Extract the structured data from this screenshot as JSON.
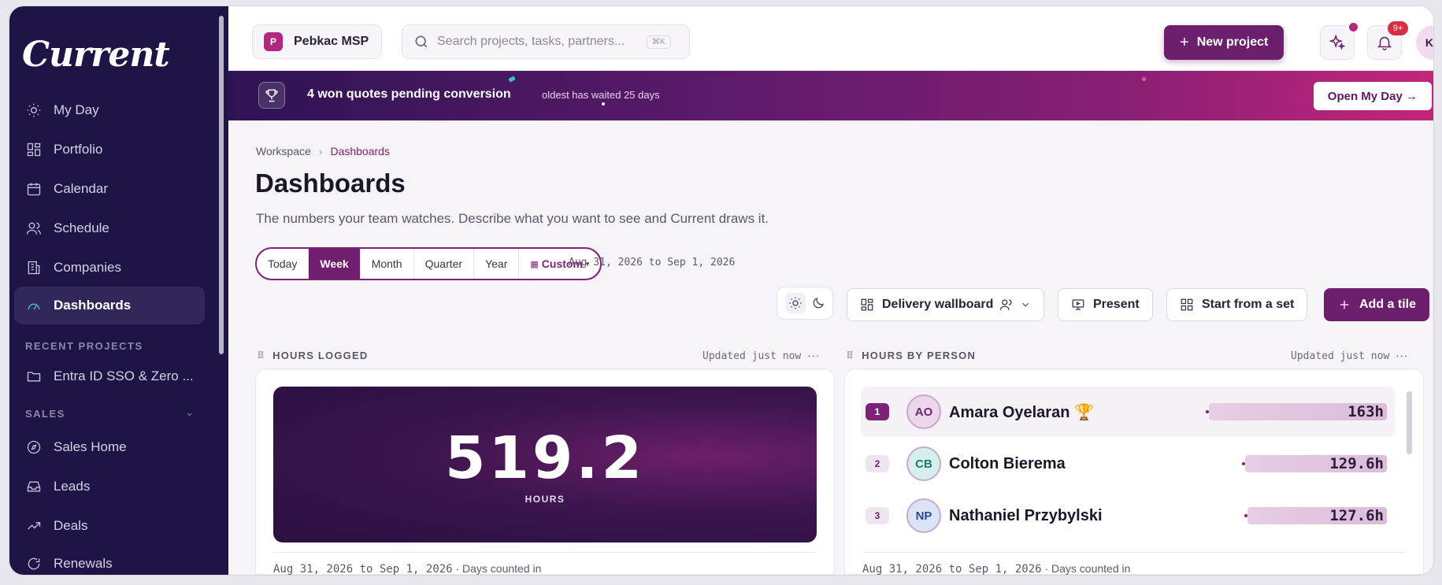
{
  "sidebar": {
    "brand": "Current",
    "nav": [
      {
        "label": "My Day",
        "icon": "sun-icon"
      },
      {
        "label": "Portfolio",
        "icon": "grid-icon"
      },
      {
        "label": "Calendar",
        "icon": "calendar-icon"
      },
      {
        "label": "Schedule",
        "icon": "people-icon"
      },
      {
        "label": "Companies",
        "icon": "building-icon"
      },
      {
        "label": "Dashboards",
        "icon": "gauge-icon",
        "active": true
      }
    ],
    "recent_title": "RECENT PROJECTS",
    "recent": [
      {
        "label": "Entra ID SSO & Zero ...",
        "icon": "folder-icon"
      }
    ],
    "sales_title": "SALES",
    "sales": [
      {
        "label": "Sales Home",
        "icon": "compass-icon"
      },
      {
        "label": "Leads",
        "icon": "inbox-icon"
      },
      {
        "label": "Deals",
        "icon": "trend-icon"
      },
      {
        "label": "Renewals",
        "icon": "refresh-icon"
      }
    ]
  },
  "topbar": {
    "workspace": {
      "badge": "P",
      "name": "Pebkac MSP"
    },
    "search": {
      "placeholder": "Search projects, tasks, partners...",
      "shortcut": "⌘K"
    },
    "new_project": "New project",
    "notif_count": "9+",
    "avatar": "KD"
  },
  "banner": {
    "title": "4 won quotes pending conversion",
    "subtitle": "oldest has waited 25 days",
    "cta": "Open My Day →"
  },
  "page": {
    "breadcrumb": [
      "Workspace",
      "Dashboards"
    ],
    "title": "Dashboards",
    "subtitle": "The numbers your team watches. Describe what you want to see and Current draws it.",
    "ranges": [
      "Today",
      "Week",
      "Month",
      "Quarter",
      "Year",
      "Custom"
    ],
    "active_range": "Week",
    "date_range": "Aug 31, 2026 to Sep 1, 2026",
    "dashboard_name": "Delivery wallboard",
    "present": "Present",
    "start_from_set": "Start from a set",
    "add_tile": "Add a tile"
  },
  "tiles": {
    "hours_logged": {
      "title": "HOURS LOGGED",
      "updated": "Updated just now",
      "value": "519.2",
      "unit": "HOURS",
      "footer_range": "Aug 31, 2026 to Sep 1, 2026",
      "footer_note": "· Days counted in"
    },
    "hours_by_person": {
      "title": "HOURS BY PERSON",
      "updated": "Updated just now",
      "footer_range": "Aug 31, 2026 to Sep 1, 2026",
      "footer_note": "· Days counted in",
      "people": [
        {
          "rank": "1",
          "initials": "AO",
          "name": "Amara Oyelaran 🏆",
          "hours": "163h",
          "value": 163,
          "avatar_bg": "#ecd6ea",
          "avatar_fg": "#6b2470"
        },
        {
          "rank": "2",
          "initials": "CB",
          "name": "Colton Bierema",
          "hours": "129.6h",
          "value": 129.6,
          "avatar_bg": "#d5f0ec",
          "avatar_fg": "#1b7a6e"
        },
        {
          "rank": "3",
          "initials": "NP",
          "name": "Nathaniel Przybylski",
          "hours": "127.6h",
          "value": 127.6,
          "avatar_bg": "#dbe3f6",
          "avatar_fg": "#2a4a8c"
        }
      ]
    }
  },
  "colors": {
    "accent": "#6b1f6d",
    "sidebar": "#201446",
    "brand_pink": "#b0297e"
  }
}
